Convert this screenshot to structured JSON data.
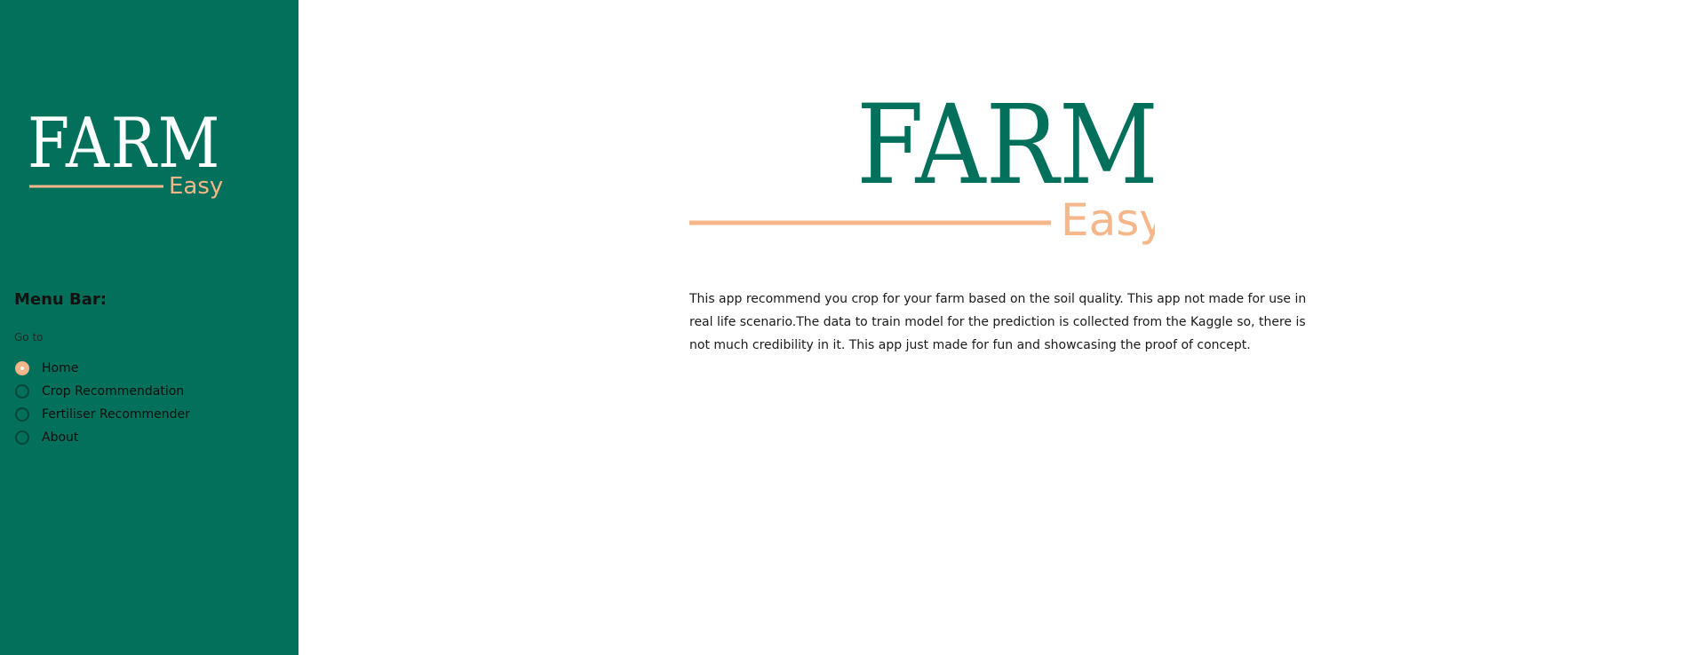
{
  "colors": {
    "sidebar_bg": "#02705b",
    "accent_peach": "#f5b68a",
    "brand_green": "#02705b",
    "text_dark": "#111111"
  },
  "sidebar": {
    "logo": {
      "primary": "FARM",
      "secondary": "Easy"
    },
    "menu_title": "Menu Bar:",
    "goto_label": "Go to",
    "options": [
      {
        "label": "Home",
        "selected": true
      },
      {
        "label": "Crop Recommendation",
        "selected": false
      },
      {
        "label": "Fertiliser Recommender",
        "selected": false
      },
      {
        "label": "About",
        "selected": false
      }
    ]
  },
  "main": {
    "logo": {
      "primary": "FARM",
      "secondary": "Easy"
    },
    "description": "This app recommend you crop for your farm based on the soil quality. This app not made for use in real life scenario.The data to train model for the prediction is collected from the Kaggle so, there is not much credibility in it. This app just made for fun and showcasing the proof of concept."
  }
}
